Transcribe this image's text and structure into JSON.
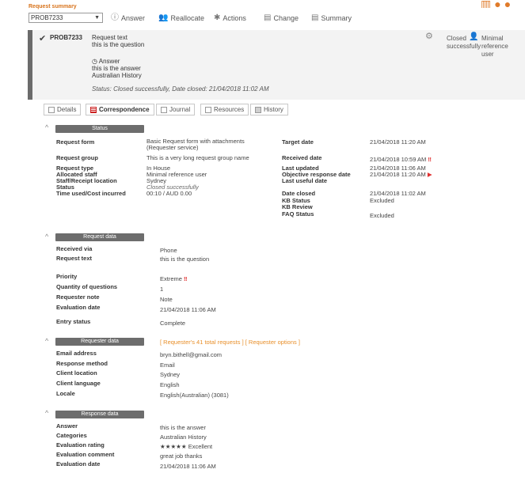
{
  "top": {
    "summary_label": "Request summary",
    "selected_request": "PROB7233",
    "toolbar": [
      {
        "label": "Answer",
        "icon": "info-circle-icon"
      },
      {
        "label": "Reallocate",
        "icon": "users-icon"
      },
      {
        "label": "Actions",
        "icon": "actions-icon"
      },
      {
        "label": "Change",
        "icon": "change-icon"
      },
      {
        "label": "Summary",
        "icon": "summary-icon"
      }
    ]
  },
  "request": {
    "id": "PROB7233",
    "text_label": "Request text",
    "question": "this is the question",
    "answer_label": "Answer",
    "answer": "this is the answer",
    "answer_category": "Australian History",
    "status_line": "Status: Closed successfully, Date closed: 21/04/2018 11:02 AM",
    "status_badge": "Closed successfully",
    "user_badge": "Minimal reference user"
  },
  "tabs": [
    "Details",
    "Correspondence",
    "Journal",
    "Resources",
    "History"
  ],
  "status_section": {
    "title": "Status",
    "left": [
      {
        "label": "Request form",
        "value": "Basic Request form with attachments (Requester service)"
      },
      {
        "label": "Request group",
        "value": "This is a very long request group name"
      },
      {
        "label": "Request type",
        "value": "In House"
      },
      {
        "label": "Allocated staff",
        "value": "Minimal reference user"
      },
      {
        "label": "Staff/Receipt location",
        "value": "Sydney"
      },
      {
        "label": "Status",
        "value": "Closed successfully"
      },
      {
        "label": "Time used/Cost incurred",
        "value": "00:10 / AUD 0.00"
      }
    ],
    "right": [
      {
        "label": "Target date",
        "value": "21/04/2018 11:20 AM"
      },
      {
        "label": "Received date",
        "value": "21/04/2018 10:59 AM"
      },
      {
        "label": "Last updated",
        "value": "21/04/2018 11:06 AM"
      },
      {
        "label": "Objective response date",
        "value": "21/04/2018 11:20 AM"
      },
      {
        "label": "Last useful date",
        "value": ""
      },
      {
        "label": "Date closed",
        "value": "21/04/2018 11:02 AM"
      },
      {
        "label": "KB Status",
        "value": "Excluded"
      },
      {
        "label": "KB Review",
        "value": ""
      },
      {
        "label": "FAQ Status",
        "value": "Excluded"
      }
    ]
  },
  "request_data": {
    "title": "Request data",
    "rows": [
      {
        "label": "Received via",
        "value": "Phone"
      },
      {
        "label": "Request text",
        "value": "this is the question"
      },
      {
        "label": "Priority",
        "value": "Extreme"
      },
      {
        "label": "Quantity of questions",
        "value": "1"
      },
      {
        "label": "Requester note",
        "value": "Note"
      },
      {
        "label": "Evaluation date",
        "value": "21/04/2018 11:06 AM"
      },
      {
        "label": "Entry status",
        "value": "Complete"
      }
    ]
  },
  "requester_data": {
    "title": "Requester data",
    "links": "[ Requester's 41 total requests ]  [ Requester options ]",
    "rows": [
      {
        "label": "Email address",
        "value": "bryn.bithell@gmail.com"
      },
      {
        "label": "Response method",
        "value": "Email"
      },
      {
        "label": "Client location",
        "value": "Sydney"
      },
      {
        "label": "Client language",
        "value": "English"
      },
      {
        "label": "Locale",
        "value": "English(Australian) (3081)"
      }
    ]
  },
  "response_data": {
    "title": "Response data",
    "rows": [
      {
        "label": "Answer",
        "value": "this is the answer"
      },
      {
        "label": "Categories",
        "value": "Australian History"
      },
      {
        "label": "Evaluation rating",
        "value": "★★★★★ Excellent"
      },
      {
        "label": "Evaluation comment",
        "value": "great job thanks"
      },
      {
        "label": "Evaluation date",
        "value": "21/04/2018 11:06 AM"
      }
    ]
  }
}
